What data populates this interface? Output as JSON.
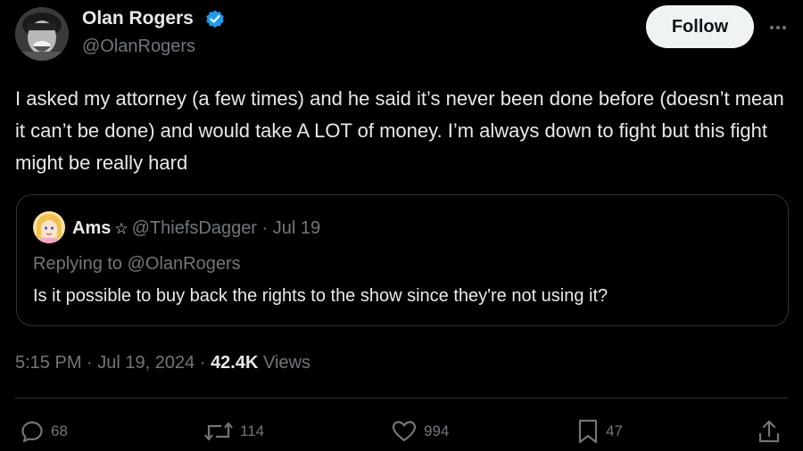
{
  "author": {
    "display_name": "Olan Rogers",
    "handle": "@OlanRogers",
    "verified_icon": "verified-badge-icon",
    "verified_color": "#1d9bf0"
  },
  "follow_label": "Follow",
  "more_icon": "more-options-icon",
  "tweet_text": "I asked my attorney (a few times) and he said it’s never been done before (doesn’t mean it can’t be done) and would take A LOT of money. I’m always down to fight but this fight might be really hard",
  "quoted": {
    "display_name": "Ams",
    "star": "☆",
    "handle": "@ThiefsDagger",
    "separator": "·",
    "date": "Jul 19",
    "replying_to": "Replying to @OlanRogers",
    "text": "Is it possible to buy back the rights to the show since they're not using it?"
  },
  "meta": {
    "time": "5:15 PM",
    "separator": "·",
    "date": "Jul 19, 2024",
    "views_count": "42.4K",
    "views_label": "Views"
  },
  "actions": {
    "replies": "68",
    "reposts": "114",
    "likes": "994",
    "bookmarks": "47"
  },
  "colors": {
    "background": "#000000",
    "text": "#e7e9ea",
    "muted": "#71767b",
    "border": "#2f3336",
    "follow_bg": "#eff3f4"
  }
}
